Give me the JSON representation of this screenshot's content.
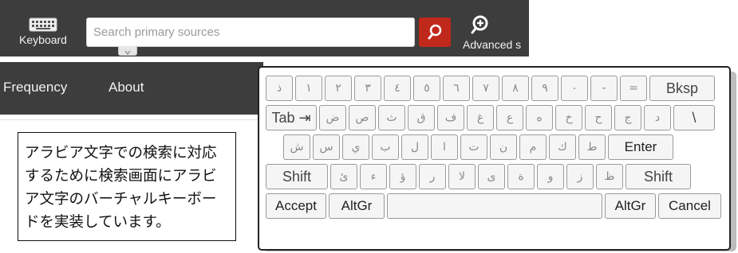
{
  "topbar": {
    "keyboard_label": "Keyboard",
    "keyboard_icon": "keyboard-icon",
    "search": {
      "placeholder": "Search primary sources",
      "value": ""
    },
    "search_icon": "search-icon",
    "advanced_label": "Advanced s",
    "advanced_icon": "advanced-search-icon"
  },
  "nav": {
    "items": [
      "Frequency",
      "About"
    ]
  },
  "callout": {
    "text": "アラビア文字での検索に対応するために検索画面にアラビア文字のバーチャルキーボードを実装しています。"
  },
  "keyboard": {
    "row1": [
      "ذ",
      "١",
      "٢",
      "٣",
      "٤",
      "٥",
      "٦",
      "٧",
      "٨",
      "٩",
      "٠",
      "-",
      "=",
      "Bksp"
    ],
    "row2": [
      "Tab ⇥",
      "ض",
      "ص",
      "ث",
      "ق",
      "ف",
      "غ",
      "ع",
      "ه",
      "خ",
      "ح",
      "ج",
      "د",
      "\\"
    ],
    "row3": [
      "ش",
      "س",
      "ي",
      "ب",
      "ل",
      "ا",
      "ت",
      "ن",
      "م",
      "ك",
      "ط",
      "Enter"
    ],
    "row4": [
      "Shift",
      "ئ",
      "ء",
      "ؤ",
      "ر",
      "لا",
      "ى",
      "ة",
      "و",
      "ز",
      "ظ",
      "Shift"
    ],
    "row5": [
      "Accept",
      "AltGr",
      "",
      "AltGr",
      "Cancel"
    ]
  }
}
